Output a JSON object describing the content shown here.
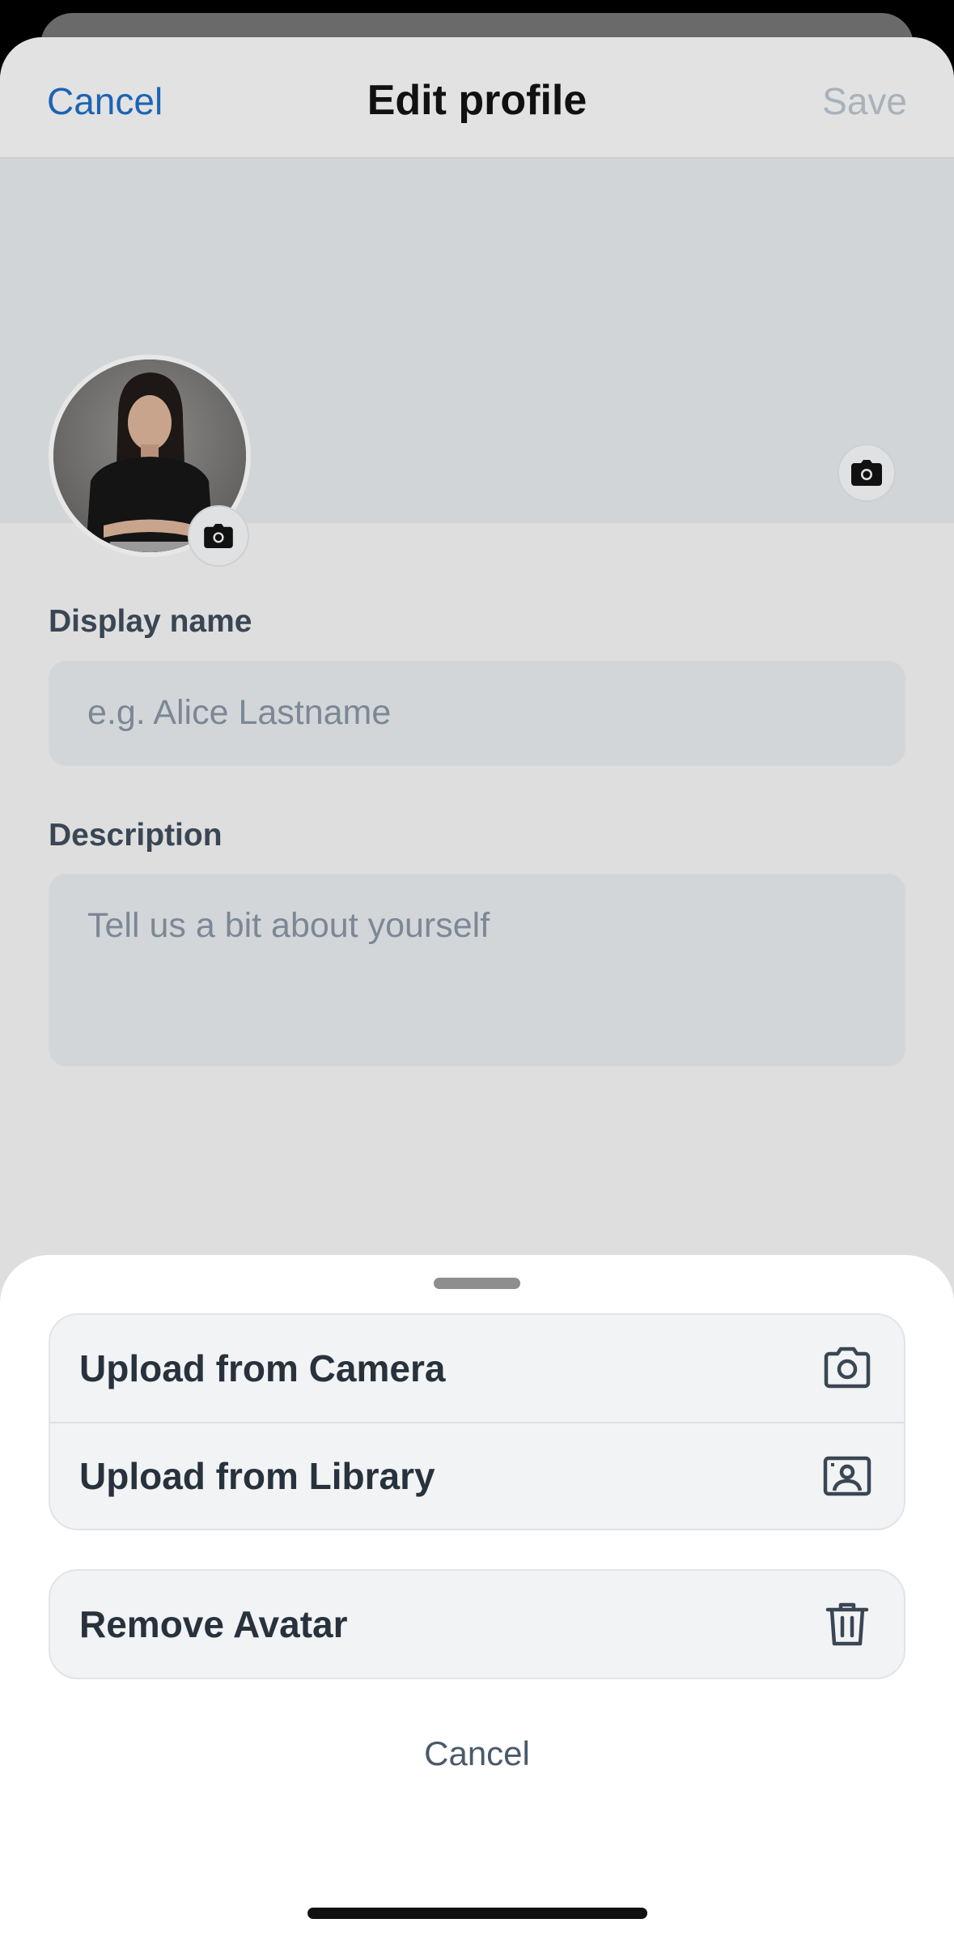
{
  "header": {
    "cancel_label": "Cancel",
    "title": "Edit profile",
    "save_label": "Save"
  },
  "form": {
    "display_name": {
      "label": "Display name",
      "placeholder": "e.g. Alice Lastname",
      "value": ""
    },
    "description": {
      "label": "Description",
      "placeholder": "Tell us a bit about yourself",
      "value": ""
    }
  },
  "action_sheet": {
    "items": [
      {
        "label": "Upload from Camera",
        "icon": "camera-outline-icon"
      },
      {
        "label": "Upload from Library",
        "icon": "photo-library-icon"
      }
    ],
    "remove_label": "Remove Avatar",
    "remove_icon": "trash-icon",
    "cancel_label": "Cancel"
  },
  "colors": {
    "accent": "#1b64b6",
    "disabled": "#a9b1ba",
    "sheet_bg": "#ffffff",
    "row_bg": "#f1f3f5"
  }
}
